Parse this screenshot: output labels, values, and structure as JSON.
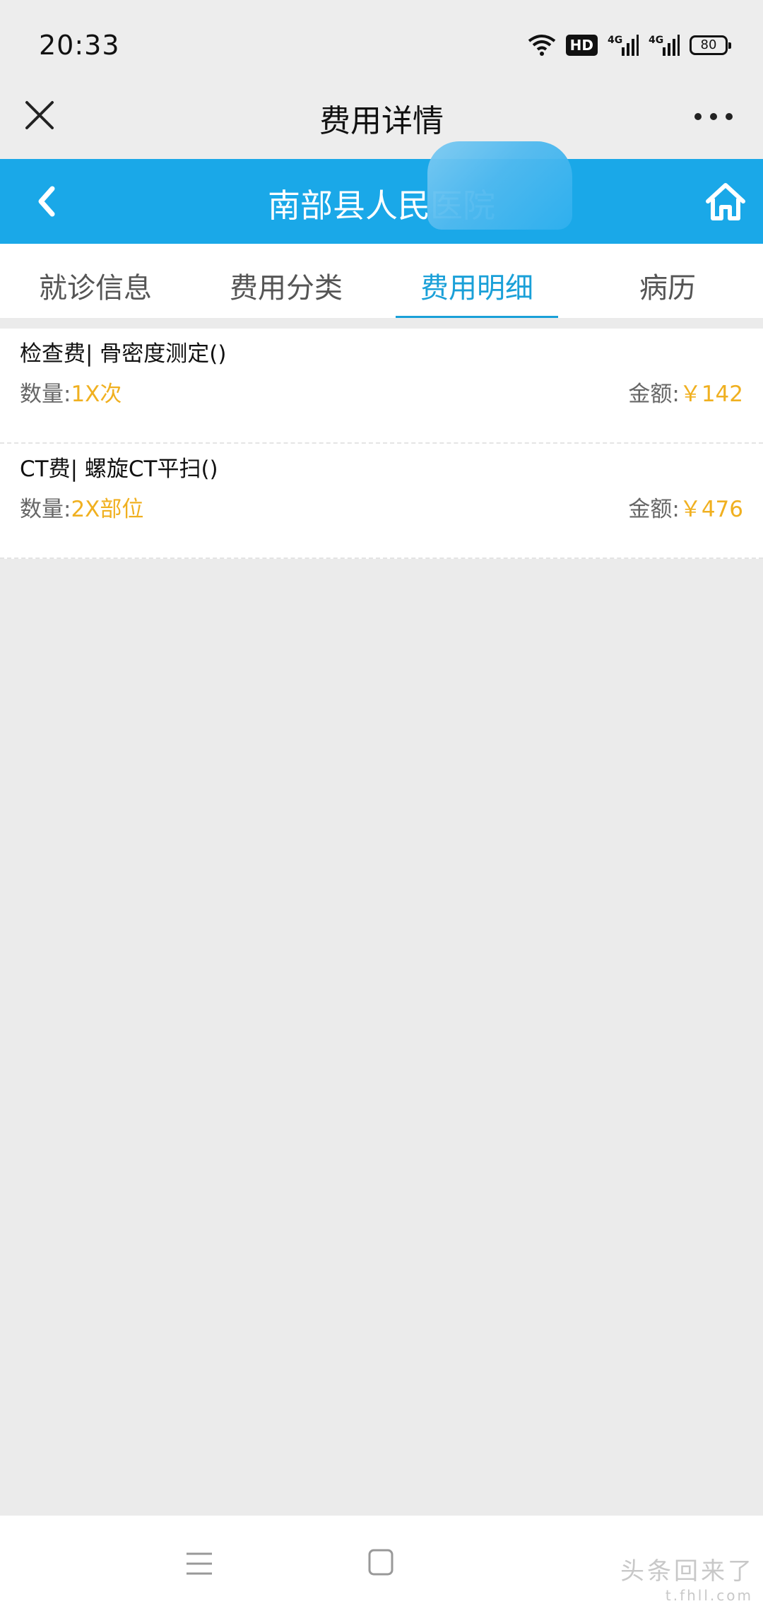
{
  "status_bar": {
    "time": "20:33",
    "hd_label": "HD",
    "battery": "80"
  },
  "title_bar": {
    "title": "费用详情"
  },
  "header": {
    "hospital": "南部县人民医院",
    "color": "#1aa8e8"
  },
  "tabs": [
    {
      "label": "就诊信息",
      "active": false
    },
    {
      "label": "费用分类",
      "active": false
    },
    {
      "label": "费用明细",
      "active": true
    },
    {
      "label": "病历",
      "active": false
    }
  ],
  "items": [
    {
      "name": "检查费| 骨密度测定()",
      "qty_label": "数量:",
      "qty_value": "1X次",
      "amount_label": "金额:",
      "amount_value": "￥142"
    },
    {
      "name": "CT费| 螺旋CT平扫()",
      "qty_label": "数量:",
      "qty_value": "2X部位",
      "amount_label": "金额:",
      "amount_value": "￥476"
    }
  ],
  "watermark": {
    "text": "头条回来了",
    "url": "t.fhll.com"
  },
  "colors": {
    "accent": "#1aa0d8",
    "value": "#f0b020"
  }
}
